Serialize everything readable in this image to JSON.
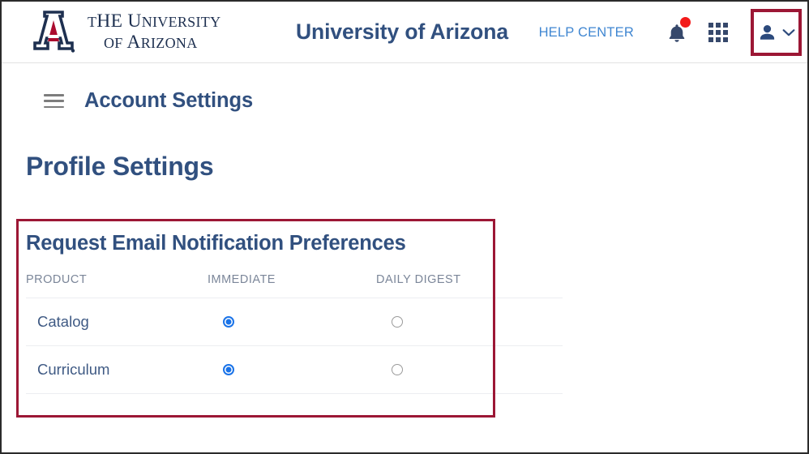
{
  "header": {
    "logo": {
      "mark_name": "university-of-arizona-block-a-logo",
      "line1_small": "T",
      "line1_rest": "HE ",
      "line1_u": "U",
      "line1_uni": "NIVERSITY",
      "line2_of": "OF ",
      "line2_a": "A",
      "line2_rizona": "RIZONA",
      "line1_full": "THE UNIVERSITY",
      "line2_full": "OF ARIZONA"
    },
    "brand_title": "University of Arizona",
    "help_center_label": "HELP CENTER",
    "notifications": {
      "icon": "bell-icon",
      "has_unread_dot": true,
      "dot_color": "#f31a1a"
    },
    "apps_grid_icon": "apps-grid-icon",
    "account_menu": {
      "icon": "person-icon",
      "chevron": "chevron-down-icon",
      "highlighted": true
    }
  },
  "page": {
    "menu_icon": "hamburger-menu-icon",
    "account_settings_title": "Account Settings",
    "profile_settings_title": "Profile Settings"
  },
  "preferences": {
    "heading": "Request Email Notification Preferences",
    "highlighted": true,
    "columns": [
      "PRODUCT",
      "IMMEDIATE",
      "DAILY DIGEST"
    ],
    "rows": [
      {
        "product": "Catalog",
        "immediate": true,
        "daily_digest": false
      },
      {
        "product": "Curriculum",
        "immediate": true,
        "daily_digest": false
      }
    ]
  },
  "colors": {
    "navy": "#31507f",
    "link_blue": "#3f86d1",
    "highlight_red": "#9c1735",
    "radio_blue": "#1a73e8",
    "muted_gray": "#7b8699",
    "logo_navy": "#1e3050",
    "logo_red": "#ab0c2f"
  }
}
